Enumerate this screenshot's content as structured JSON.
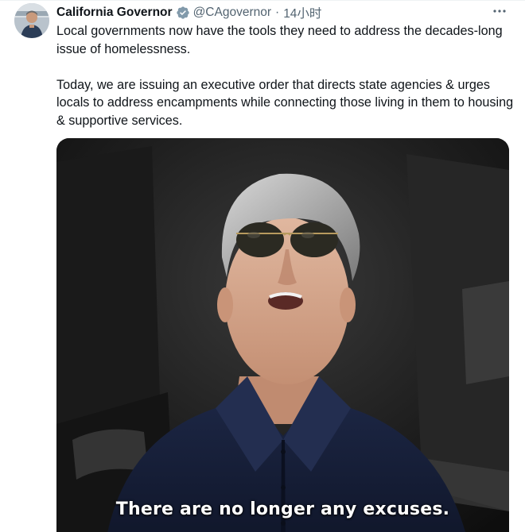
{
  "tweet": {
    "author": {
      "display_name": "California Governor",
      "handle": "@CAgovernor",
      "verified": true,
      "avatar_icon": "governor-avatar"
    },
    "separator": "·",
    "timestamp": "14小时",
    "more_icon": "more-options-icon",
    "paragraphs": [
      "Local governments now have the tools they need to address the decades-long issue of homelessness.",
      "Today, we are issuing an executive order that directs state agencies & urges locals to address encampments while connecting those living in them to housing & supportive services."
    ],
    "media": {
      "type": "video",
      "caption": "There are no longer any excuses."
    }
  },
  "colors": {
    "text_primary": "#0f1419",
    "text_secondary": "#536471",
    "verified_badge": "#829aab",
    "background": "#ffffff"
  }
}
